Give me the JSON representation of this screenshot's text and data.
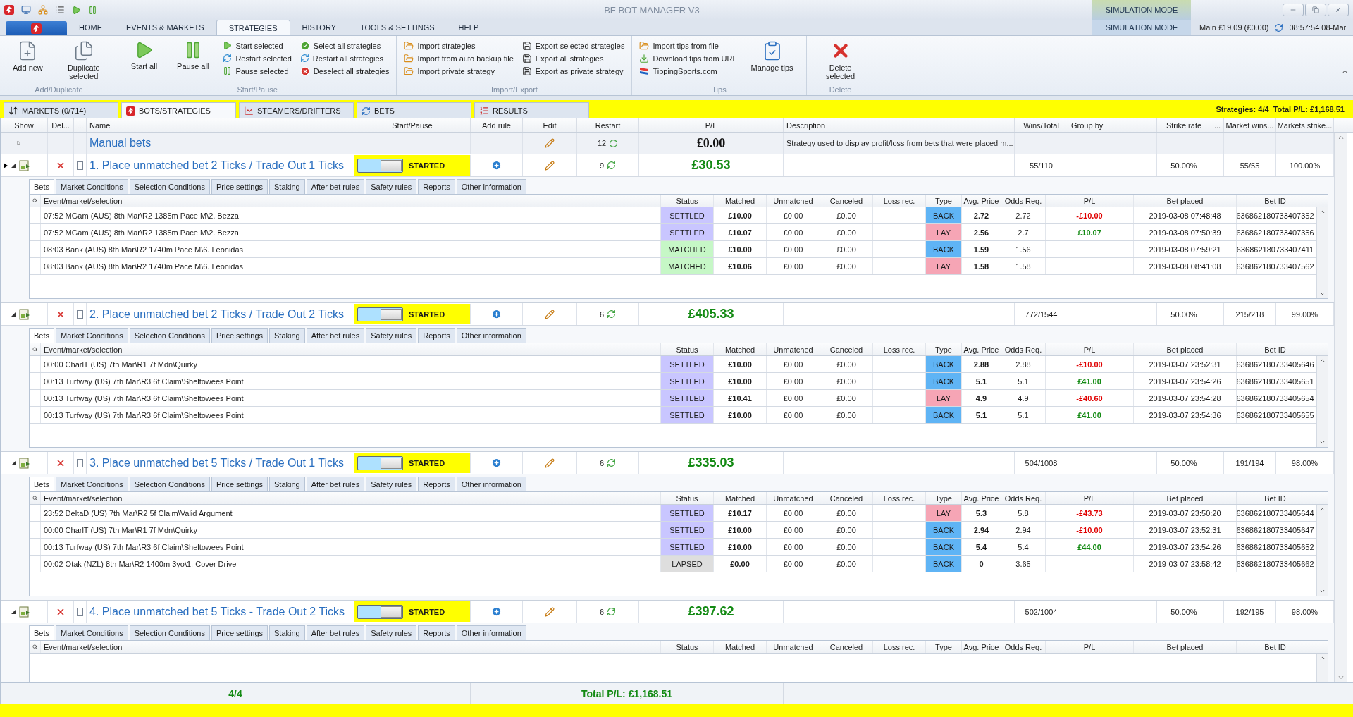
{
  "title_bar": {
    "title": "BF BOT MANAGER V3",
    "mode": "SIMULATION MODE"
  },
  "ribbon": {
    "tabs": [
      {
        "label": "HOME",
        "selected": false
      },
      {
        "label": "EVENTS & MARKETS",
        "selected": false
      },
      {
        "label": "STRATEGIES",
        "selected": true
      },
      {
        "label": "HISTORY",
        "selected": false
      },
      {
        "label": "TOOLS & SETTINGS",
        "selected": false
      },
      {
        "label": "HELP",
        "selected": false
      }
    ],
    "mode": "SIMULATION MODE",
    "balance": "Main £19.09 (£0.00)",
    "clock": "08:57:54 08-Mar",
    "groups": [
      {
        "label": "Add/Duplicate",
        "columns": [
          {
            "kind": "large",
            "items": [
              "Add new"
            ]
          },
          {
            "kind": "large",
            "items": [
              "Duplicate selected"
            ]
          }
        ]
      },
      {
        "label": "Start/Pause",
        "columns": [
          {
            "kind": "large",
            "items": [
              "Start all"
            ]
          },
          {
            "kind": "large",
            "items": [
              "Pause all"
            ]
          },
          {
            "kind": "stack",
            "items": [
              "Start selected",
              "Restart selected",
              "Pause selected"
            ]
          },
          {
            "kind": "stack",
            "items": [
              "Select all strategies",
              "Restart all strategies",
              "Deselect all strategies"
            ]
          }
        ]
      },
      {
        "label": "Import/Export",
        "columns": [
          {
            "kind": "stack",
            "items": [
              "Import strategies",
              "Import from auto backup file",
              "Import private strategy"
            ]
          },
          {
            "kind": "stack",
            "items": [
              "Export selected strategies",
              "Export all strategies",
              "Export as private strategy"
            ]
          }
        ]
      },
      {
        "label": "Tips",
        "columns": [
          {
            "kind": "stack",
            "items": [
              "Import tips from file",
              "Download tips from URL",
              "TippingSports.com"
            ]
          },
          {
            "kind": "large",
            "items": [
              "Manage tips"
            ]
          }
        ]
      },
      {
        "label": "Delete",
        "columns": [
          {
            "kind": "large",
            "items": [
              "Delete selected"
            ]
          }
        ]
      }
    ]
  },
  "view_tabs": [
    {
      "label": "MARKETS (0/714)",
      "selected": false
    },
    {
      "label": "BOTS/STRATEGIES",
      "selected": true
    },
    {
      "label": "STEAMERS/DRIFTERS",
      "selected": false
    },
    {
      "label": "BETS",
      "selected": false
    },
    {
      "label": "RESULTS",
      "selected": false
    }
  ],
  "summary": "Strategies: 4/4  Total P/L: £1,168.51",
  "grid": {
    "columns": [
      "Show",
      "Del...",
      "...",
      "Name",
      "Start/Pause",
      "Add rule",
      "Edit",
      "Restart",
      "P/L",
      "Description",
      "Wins/Total",
      "Group by",
      "Strike rate",
      "...",
      "Market wins...",
      "Markets strike..."
    ],
    "manual": {
      "name": "Manual bets",
      "expanded": false,
      "restart": "12",
      "pl": "£0.00",
      "description": "Strategy used to display profit/loss from bets that were placed m..."
    },
    "strategies": [
      {
        "name": "1. Place unmatched bet 2 Ticks / Trade Out 1 Ticks",
        "current": true,
        "expanded": true,
        "checked": false,
        "on": true,
        "status": "STARTED",
        "restart": "9",
        "pl": "£30.53",
        "wins_total": "55/110",
        "strike_rate": "50.00%",
        "market_wins": "55/55",
        "markets_strike": "100.00%",
        "detail_tabs": [
          {
            "label": "Bets",
            "selected": true
          },
          {
            "label": "Market Conditions",
            "selected": false
          },
          {
            "label": "Selection Conditions",
            "selected": false
          },
          {
            "label": "Price settings",
            "selected": false
          },
          {
            "label": "Staking",
            "selected": false
          },
          {
            "label": "After bet rules",
            "selected": false
          },
          {
            "label": "Safety rules",
            "selected": false
          },
          {
            "label": "Reports",
            "selected": false
          },
          {
            "label": "Other information",
            "selected": false
          }
        ],
        "bet_columns": [
          "Event/market/selection",
          "Status",
          "Matched",
          "Unmatched",
          "Canceled",
          "Loss rec.",
          "Type",
          "Avg. Price",
          "Odds Req.",
          "P/L",
          "Bet placed",
          "Bet ID"
        ],
        "bets": [
          {
            "event": "07:52 MGam (AUS) 8th Mar\\R2 1385m Pace M\\2. Bezza",
            "status": "SETTLED",
            "color": "#c9c6ff",
            "matched": "£10.00",
            "unmatched": "£0.00",
            "canceled": "£0.00",
            "type": "BACK",
            "lay": false,
            "avg_price": "2.72",
            "odds_req": "2.72",
            "pl": "-£10.00",
            "loss": true,
            "placed": "2019-03-08 07:48:48",
            "id": "636862180733407352"
          },
          {
            "event": "07:52 MGam (AUS) 8th Mar\\R2 1385m Pace M\\2. Bezza",
            "status": "SETTLED",
            "color": "#c9c6ff",
            "matched": "£10.07",
            "unmatched": "£0.00",
            "canceled": "£0.00",
            "type": "LAY",
            "lay": true,
            "avg_price": "2.56",
            "odds_req": "2.7",
            "pl": "£10.07",
            "loss": false,
            "placed": "2019-03-08 07:50:39",
            "id": "636862180733407356"
          },
          {
            "event": "08:03 Bank (AUS) 8th Mar\\R2 1740m Pace M\\6. Leonidas",
            "status": "MATCHED",
            "color": "#c6f7c6",
            "matched": "£10.00",
            "unmatched": "£0.00",
            "canceled": "£0.00",
            "type": "BACK",
            "lay": false,
            "avg_price": "1.59",
            "odds_req": "1.56",
            "placed": "2019-03-08 07:59:21",
            "id": "636862180733407411"
          },
          {
            "event": "08:03 Bank (AUS) 8th Mar\\R2 1740m Pace M\\6. Leonidas",
            "status": "MATCHED",
            "color": "#c6f7c6",
            "matched": "£10.06",
            "unmatched": "£0.00",
            "canceled": "£0.00",
            "type": "LAY",
            "lay": true,
            "avg_price": "1.58",
            "odds_req": "1.58",
            "placed": "2019-03-08 08:41:08",
            "id": "636862180733407562"
          }
        ]
      },
      {
        "name": "2. Place unmatched bet 2 Ticks / Trade Out 2 Ticks",
        "current": false,
        "expanded": true,
        "checked": false,
        "on": true,
        "status": "STARTED",
        "restart": "6",
        "pl": "£405.33",
        "wins_total": "772/1544",
        "strike_rate": "50.00%",
        "market_wins": "215/218",
        "markets_strike": "99.00%",
        "detail_tabs": [
          {
            "label": "Bets",
            "selected": true
          },
          {
            "label": "Market Conditions",
            "selected": false
          },
          {
            "label": "Selection Conditions",
            "selected": false
          },
          {
            "label": "Price settings",
            "selected": false
          },
          {
            "label": "Staking",
            "selected": false
          },
          {
            "label": "After bet rules",
            "selected": false
          },
          {
            "label": "Safety rules",
            "selected": false
          },
          {
            "label": "Reports",
            "selected": false
          },
          {
            "label": "Other information",
            "selected": false
          }
        ],
        "bet_columns": [
          "Event/market/selection",
          "Status",
          "Matched",
          "Unmatched",
          "Canceled",
          "Loss rec.",
          "Type",
          "Avg. Price",
          "Odds Req.",
          "P/L",
          "Bet placed",
          "Bet ID"
        ],
        "bets": [
          {
            "event": "00:00 CharlT (US) 7th Mar\\R1 7f Mdn\\Quirky",
            "status": "SETTLED",
            "color": "#c9c6ff",
            "matched": "£10.00",
            "unmatched": "£0.00",
            "canceled": "£0.00",
            "type": "BACK",
            "lay": false,
            "avg_price": "2.88",
            "odds_req": "2.88",
            "pl": "-£10.00",
            "loss": true,
            "placed": "2019-03-07 23:52:31",
            "id": "636862180733405646"
          },
          {
            "event": "00:13 Turfway (US) 7th Mar\\R3 6f Claim\\Sheltowees Point",
            "status": "SETTLED",
            "color": "#c9c6ff",
            "matched": "£10.00",
            "unmatched": "£0.00",
            "canceled": "£0.00",
            "type": "BACK",
            "lay": false,
            "avg_price": "5.1",
            "odds_req": "5.1",
            "pl": "£41.00",
            "loss": false,
            "placed": "2019-03-07 23:54:26",
            "id": "636862180733405651"
          },
          {
            "event": "00:13 Turfway (US) 7th Mar\\R3 6f Claim\\Sheltowees Point",
            "status": "SETTLED",
            "color": "#c9c6ff",
            "matched": "£10.41",
            "unmatched": "£0.00",
            "canceled": "£0.00",
            "type": "LAY",
            "lay": true,
            "avg_price": "4.9",
            "odds_req": "4.9",
            "pl": "-£40.60",
            "loss": true,
            "placed": "2019-03-07 23:54:28",
            "id": "636862180733405654"
          },
          {
            "event": "00:13 Turfway (US) 7th Mar\\R3 6f Claim\\Sheltowees Point",
            "status": "SETTLED",
            "color": "#c9c6ff",
            "matched": "£10.00",
            "unmatched": "£0.00",
            "canceled": "£0.00",
            "type": "BACK",
            "lay": false,
            "avg_price": "5.1",
            "odds_req": "5.1",
            "pl": "£41.00",
            "loss": false,
            "placed": "2019-03-07 23:54:36",
            "id": "636862180733405655"
          }
        ]
      },
      {
        "name": "3. Place unmatched bet 5 Ticks / Trade Out 1 Ticks",
        "current": false,
        "expanded": true,
        "checked": false,
        "on": true,
        "status": "STARTED",
        "restart": "6",
        "pl": "£335.03",
        "wins_total": "504/1008",
        "strike_rate": "50.00%",
        "market_wins": "191/194",
        "markets_strike": "98.00%",
        "detail_tabs": [
          {
            "label": "Bets",
            "selected": true
          },
          {
            "label": "Market Conditions",
            "selected": false
          },
          {
            "label": "Selection Conditions",
            "selected": false
          },
          {
            "label": "Price settings",
            "selected": false
          },
          {
            "label": "Staking",
            "selected": false
          },
          {
            "label": "After bet rules",
            "selected": false
          },
          {
            "label": "Safety rules",
            "selected": false
          },
          {
            "label": "Reports",
            "selected": false
          },
          {
            "label": "Other information",
            "selected": false
          }
        ],
        "bet_columns": [
          "Event/market/selection",
          "Status",
          "Matched",
          "Unmatched",
          "Canceled",
          "Loss rec.",
          "Type",
          "Avg. Price",
          "Odds Req.",
          "P/L",
          "Bet placed",
          "Bet ID"
        ],
        "bets": [
          {
            "event": "23:52 DeltaD (US) 7th Mar\\R2 5f Claim\\Valid Argument",
            "status": "SETTLED",
            "color": "#c9c6ff",
            "matched": "£10.17",
            "unmatched": "£0.00",
            "canceled": "£0.00",
            "type": "LAY",
            "lay": true,
            "avg_price": "5.3",
            "odds_req": "5.8",
            "pl": "-£43.73",
            "loss": true,
            "placed": "2019-03-07 23:50:20",
            "id": "636862180733405644"
          },
          {
            "event": "00:00 CharlT (US) 7th Mar\\R1 7f Mdn\\Quirky",
            "status": "SETTLED",
            "color": "#c9c6ff",
            "matched": "£10.00",
            "unmatched": "£0.00",
            "canceled": "£0.00",
            "type": "BACK",
            "lay": false,
            "avg_price": "2.94",
            "odds_req": "2.94",
            "pl": "-£10.00",
            "loss": true,
            "placed": "2019-03-07 23:52:31",
            "id": "636862180733405647"
          },
          {
            "event": "00:13 Turfway (US) 7th Mar\\R3 6f Claim\\Sheltowees Point",
            "status": "SETTLED",
            "color": "#c9c6ff",
            "matched": "£10.00",
            "unmatched": "£0.00",
            "canceled": "£0.00",
            "type": "BACK",
            "lay": false,
            "avg_price": "5.4",
            "odds_req": "5.4",
            "pl": "£44.00",
            "loss": false,
            "placed": "2019-03-07 23:54:26",
            "id": "636862180733405652"
          },
          {
            "event": "00:02 Otak (NZL) 8th Mar\\R2 1400m 3yo\\1. Cover Drive",
            "status": "LAPSED",
            "color": "#dedede",
            "matched": "£0.00",
            "unmatched": "£0.00",
            "canceled": "£0.00",
            "type": "BACK",
            "lay": false,
            "avg_price": "0",
            "odds_req": "3.65",
            "placed": "2019-03-07 23:58:42",
            "id": "636862180733405662"
          }
        ]
      },
      {
        "name": "4. Place unmatched bet 5 Ticks - Trade Out 2 Ticks",
        "current": false,
        "expanded": true,
        "checked": false,
        "on": true,
        "status": "STARTED",
        "restart": "6",
        "pl": "£397.62",
        "wins_total": "502/1004",
        "strike_rate": "50.00%",
        "market_wins": "192/195",
        "markets_strike": "98.00%",
        "detail_tabs": [
          {
            "label": "Bets",
            "selected": true
          },
          {
            "label": "Market Conditions",
            "selected": false
          },
          {
            "label": "Selection Conditions",
            "selected": false
          },
          {
            "label": "Price settings",
            "selected": false
          },
          {
            "label": "Staking",
            "selected": false
          },
          {
            "label": "After bet rules",
            "selected": false
          },
          {
            "label": "Safety rules",
            "selected": false
          },
          {
            "label": "Reports",
            "selected": false
          },
          {
            "label": "Other information",
            "selected": false
          }
        ],
        "bet_columns": [
          "Event/market/selection",
          "Status",
          "Matched",
          "Unmatched",
          "Canceled",
          "Loss rec.",
          "Type",
          "Avg. Price",
          "Odds Req.",
          "P/L",
          "Bet placed",
          "Bet ID"
        ]
      }
    ]
  },
  "footer": {
    "count": "4/4",
    "total": "Total P/L: £1,168.51"
  }
}
